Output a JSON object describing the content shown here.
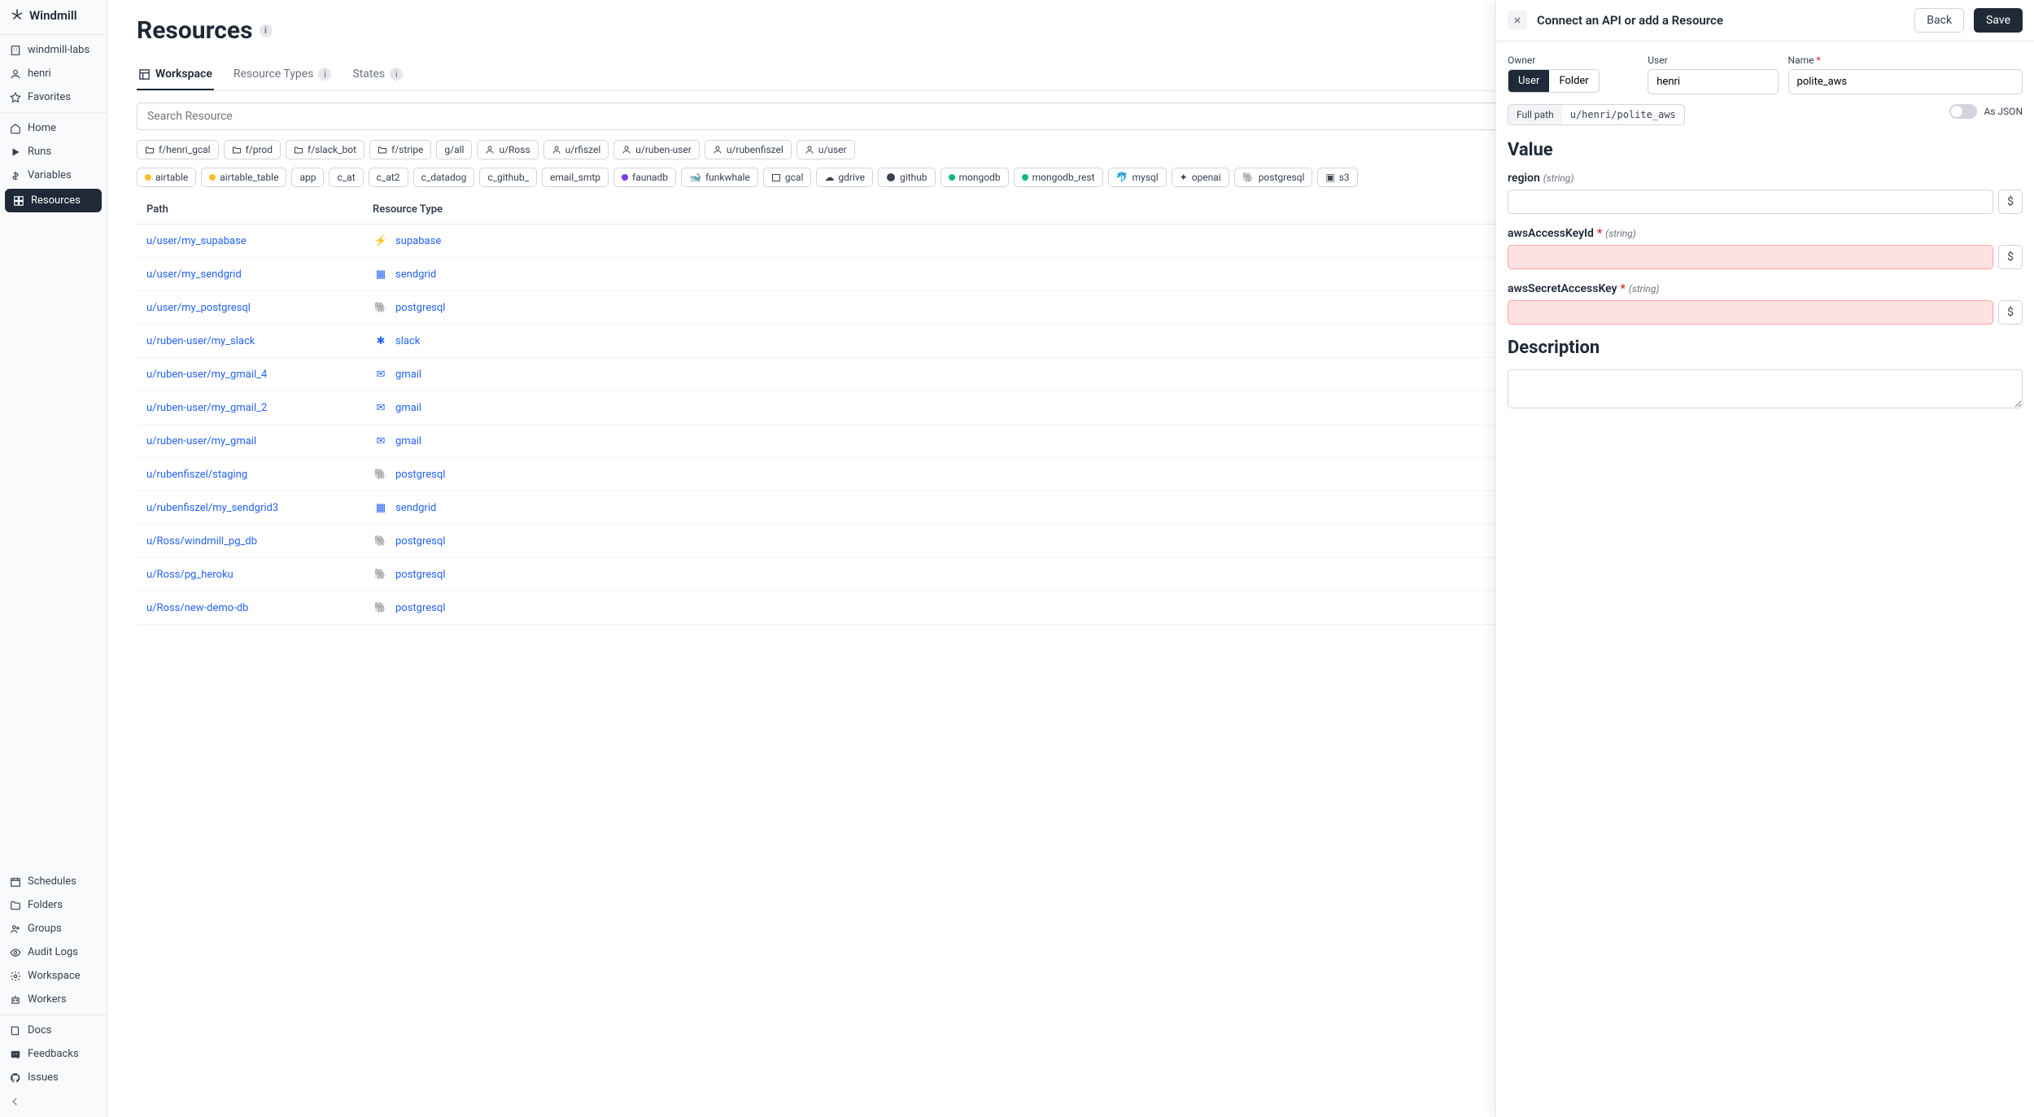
{
  "app": {
    "name": "Windmill"
  },
  "workspace": {
    "name": "windmill-labs",
    "user": "henri",
    "favorites": "Favorites"
  },
  "nav": {
    "home": "Home",
    "runs": "Runs",
    "variables": "Variables",
    "resources": "Resources",
    "schedules": "Schedules",
    "folders": "Folders",
    "groups": "Groups",
    "audit": "Audit Logs",
    "workspace_settings": "Workspace",
    "workers": "Workers",
    "docs": "Docs",
    "feedbacks": "Feedbacks",
    "issues": "Issues"
  },
  "page": {
    "title": "Resources",
    "tabs": {
      "workspace": "Workspace",
      "types": "Resource Types",
      "states": "States"
    },
    "search_placeholder": "Search Resource"
  },
  "filters": {
    "folders": [
      "f/henri_gcal",
      "f/prod",
      "f/slack_bot",
      "f/stripe"
    ],
    "groups": [
      "g/all"
    ],
    "users": [
      "u/Ross",
      "u/rfiszel",
      "u/ruben-user",
      "u/rubenfiszel",
      "u/user"
    ],
    "types": [
      "airtable",
      "airtable_table",
      "app",
      "c_at",
      "c_at2",
      "c_datadog",
      "c_github_",
      "email_smtp",
      "faunadb",
      "funkwhale",
      "gcal",
      "gdrive",
      "github",
      "mongodb",
      "mongodb_rest",
      "mysql",
      "openai",
      "postgresql",
      "s3"
    ]
  },
  "table": {
    "headers": {
      "path": "Path",
      "type": "Resource Type"
    },
    "rows": [
      {
        "path": "u/user/my_supabase",
        "type": "supabase"
      },
      {
        "path": "u/user/my_sendgrid",
        "type": "sendgrid"
      },
      {
        "path": "u/user/my_postgresql",
        "type": "postgresql"
      },
      {
        "path": "u/ruben-user/my_slack",
        "type": "slack"
      },
      {
        "path": "u/ruben-user/my_gmail_4",
        "type": "gmail"
      },
      {
        "path": "u/ruben-user/my_gmail_2",
        "type": "gmail"
      },
      {
        "path": "u/ruben-user/my_gmail",
        "type": "gmail"
      },
      {
        "path": "u/rubenfiszel/staging",
        "type": "postgresql"
      },
      {
        "path": "u/rubenfiszel/my_sendgrid3",
        "type": "sendgrid"
      },
      {
        "path": "u/Ross/windmill_pg_db",
        "type": "postgresql"
      },
      {
        "path": "u/Ross/pg_heroku",
        "type": "postgresql"
      },
      {
        "path": "u/Ross/new-demo-db",
        "type": "postgresql"
      }
    ]
  },
  "drawer": {
    "title": "Connect an API or add a Resource",
    "back": "Back",
    "save": "Save",
    "owner_label": "Owner",
    "user_label": "User",
    "name_label": "Name",
    "owner_kind": {
      "user": "User",
      "folder": "Folder"
    },
    "user_value": "henri",
    "name_value": "polite_aws",
    "fullpath_label": "Full path",
    "fullpath_value": "u/henri/polite_aws",
    "value_title": "Value",
    "as_json": "As JSON",
    "fields": {
      "region": {
        "label": "region",
        "hint": "(string)"
      },
      "awsAccessKeyId": {
        "label": "awsAccessKeyId",
        "required": true,
        "hint": "(string)"
      },
      "awsSecretAccessKey": {
        "label": "awsSecretAccessKey",
        "required": true,
        "hint": "(string)"
      }
    },
    "description_title": "Description"
  }
}
